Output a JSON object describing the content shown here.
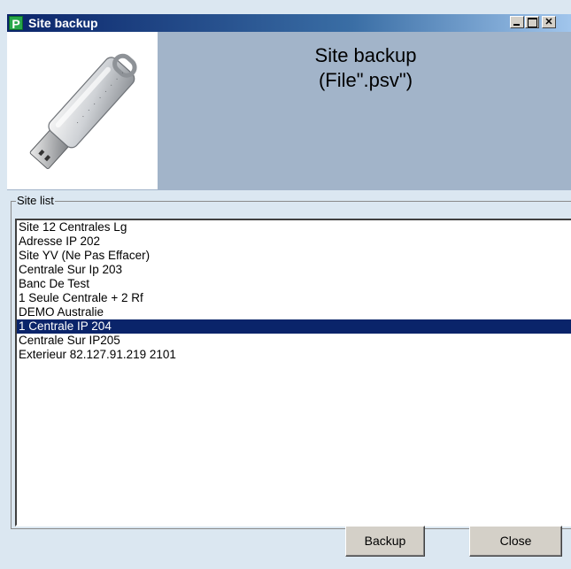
{
  "window": {
    "title": "Site backup",
    "app_icon_letter": "P"
  },
  "header": {
    "title": "Site backup",
    "subtitle": "(File\".psv\")",
    "image_icon": "usb-drive-icon"
  },
  "site_list": {
    "label": "Site list",
    "items": [
      "Site 12 Centrales Lg",
      "Adresse IP 202",
      "Site YV (Ne Pas Effacer)",
      "Centrale Sur Ip 203",
      "Banc De Test",
      "1 Seule Centrale + 2 Rf",
      "DEMO Australie",
      "1 Centrale IP 204",
      "Centrale Sur IP205",
      "Exterieur 82.127.91.219 2101"
    ],
    "selected_index": 7
  },
  "buttons": {
    "backup": "Backup",
    "close": "Close"
  },
  "colors": {
    "selection": "#0a246a",
    "header_bg": "#a2b4c9",
    "window_bg": "#dbe7f1"
  }
}
